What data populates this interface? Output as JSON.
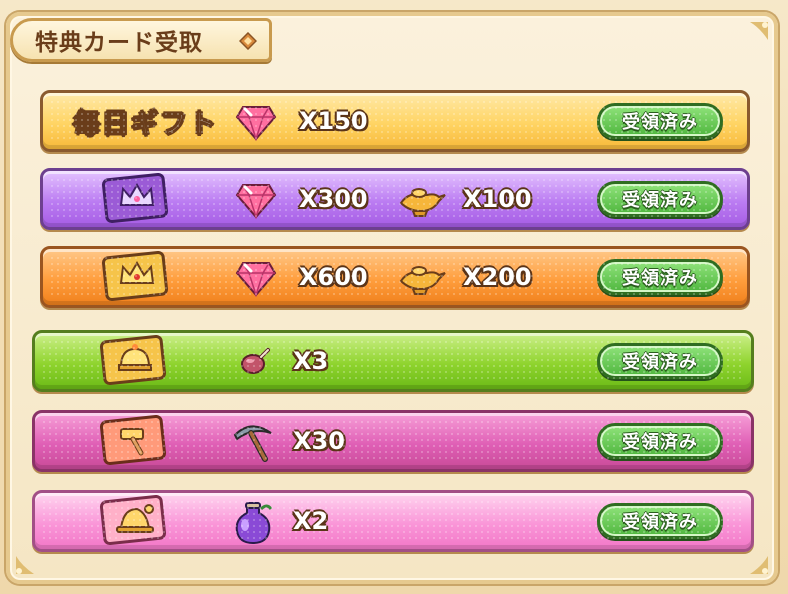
{
  "panel": {
    "title": "特典カード受取",
    "title_icon": "diamond-ornament-icon"
  },
  "rows": [
    {
      "label": "毎日ギフト",
      "reward1": {
        "icon": "gem-icon",
        "amount": "X150"
      },
      "reward2": null,
      "button": "受領済み",
      "theme": "gold"
    },
    {
      "badge": "purple-crown-card-icon",
      "reward1": {
        "icon": "gem-icon",
        "amount": "X300"
      },
      "reward2": {
        "icon": "magic-lamp-icon",
        "amount": "X100"
      },
      "button": "受領済み",
      "theme": "purple"
    },
    {
      "badge": "gold-crown-card-icon",
      "reward1": {
        "icon": "gem-icon",
        "amount": "X600"
      },
      "reward2": {
        "icon": "magic-lamp-icon",
        "amount": "X200"
      },
      "button": "受領済み",
      "theme": "orange"
    },
    {
      "badge": "helmet-card-icon",
      "reward1": {
        "icon": "meat-icon",
        "amount": "X3"
      },
      "button": "受領済み",
      "theme": "green"
    },
    {
      "badge": "hammer-card-icon",
      "reward1": {
        "icon": "pickaxe-icon",
        "amount": "X30"
      },
      "button": "受領済み",
      "theme": "pink"
    },
    {
      "badge": "hat-card-icon",
      "reward1": {
        "icon": "potion-icon",
        "amount": "X2"
      },
      "button": "受領済み",
      "theme": "light-pink"
    }
  ]
}
